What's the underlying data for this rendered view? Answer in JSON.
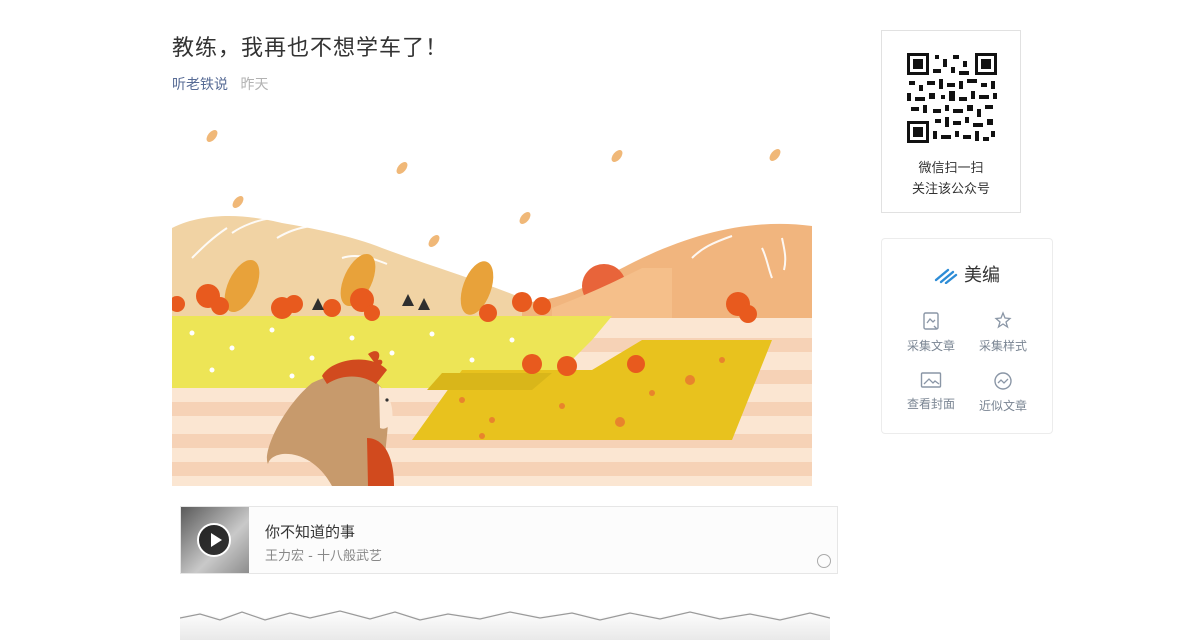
{
  "article": {
    "title": "教练，我再也不想学车了！",
    "author": "听老铁说",
    "date": "昨天"
  },
  "music": {
    "title": "你不知道的事",
    "artist": "王力宏 - 十八般武艺",
    "icon": "play-icon"
  },
  "qr": {
    "line1": "微信扫一扫",
    "line2": "关注该公众号"
  },
  "tools": {
    "brand": "美编",
    "items": [
      {
        "label": "采集文章",
        "icon": "collect-article-icon"
      },
      {
        "label": "采集样式",
        "icon": "collect-style-icon"
      },
      {
        "label": "查看封面",
        "icon": "view-cover-icon"
      },
      {
        "label": "近似文章",
        "icon": "similar-article-icon"
      }
    ]
  },
  "colors": {
    "link": "#576b95",
    "muted": "#b2b2b2",
    "tool_text": "#7a8593",
    "illustration_yellow": "#e8c21e",
    "illustration_orange": "#e86a2a"
  }
}
